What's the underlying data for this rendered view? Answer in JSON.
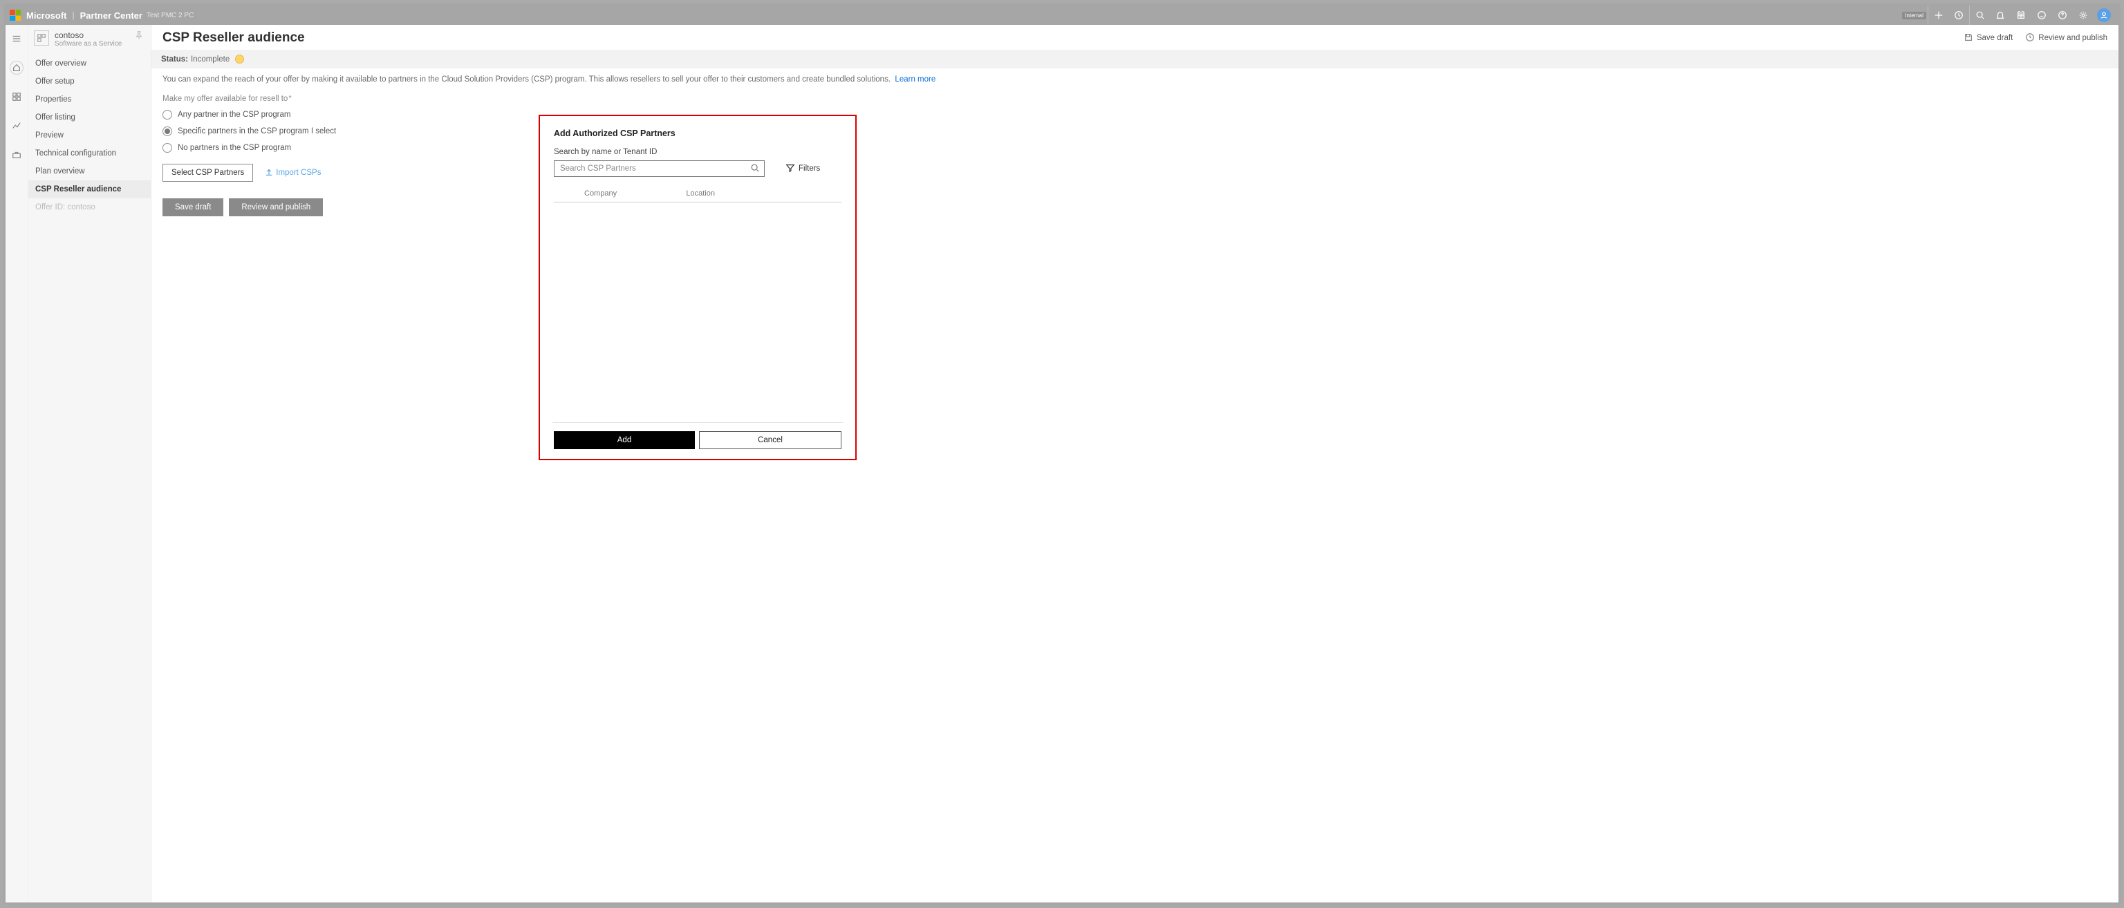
{
  "topbar": {
    "brand": "Microsoft",
    "product": "Partner Center",
    "env": "Test PMC 2 PC",
    "badge": "Internal"
  },
  "product_context": {
    "name": "contoso",
    "subtitle": "Software as a Service"
  },
  "nav": {
    "items": [
      "Offer overview",
      "Offer setup",
      "Properties",
      "Offer listing",
      "Preview",
      "Technical configuration",
      "Plan overview",
      "CSP Reseller audience"
    ],
    "disabled": "Offer ID: contoso",
    "active_index": 7
  },
  "page": {
    "title": "CSP Reseller audience",
    "actions": {
      "save_draft": "Save draft",
      "review_publish": "Review and publish"
    },
    "status_label": "Status:",
    "status_value": "Incomplete",
    "description": "You can expand the reach of your offer by making it available to partners in the Cloud Solution Providers (CSP) program. This allows resellers to sell your offer to their customers and create bundled solutions.",
    "learn_more": "Learn more",
    "field_label": "Make my offer available for resell to",
    "radios": [
      "Any partner in the CSP program",
      "Specific partners in the CSP program I select",
      "No partners in the CSP program"
    ],
    "selected_radio": 1,
    "select_btn": "Select CSP Partners",
    "import_link": "Import CSPs",
    "footer_save": "Save draft",
    "footer_publish": "Review and publish"
  },
  "panel": {
    "title": "Add Authorized CSP Partners",
    "sub": "Search by name or Tenant ID",
    "search_placeholder": "Search CSP Partners",
    "filters": "Filters",
    "col_company": "Company",
    "col_location": "Location",
    "add": "Add",
    "cancel": "Cancel"
  }
}
